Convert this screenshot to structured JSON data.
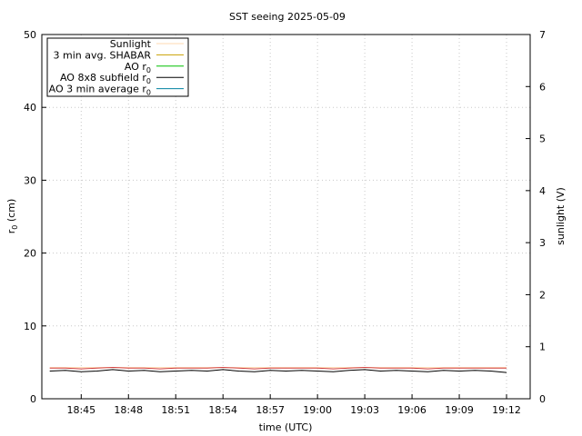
{
  "chart_data": {
    "type": "line",
    "title": "SST seeing 2025-05-09",
    "xlabel": "time (UTC)",
    "ylabel": "r",
    "ylabel_sub": "0",
    "ylabel_unit": " (cm)",
    "y2label": "sunlight (V)",
    "xlim": [
      "18:42:30",
      "18:13:30"
    ],
    "x_range_minutes": [
      1122.5,
      1153.5
    ],
    "ylim": [
      0,
      50
    ],
    "y2lim": [
      0,
      7
    ],
    "x_ticks": [
      "18:45",
      "18:48",
      "18:51",
      "18:54",
      "18:57",
      "19:00",
      "19:03",
      "19:06",
      "19:09",
      "19:12"
    ],
    "y_ticks": [
      0,
      10,
      20,
      30,
      40,
      50
    ],
    "y2_ticks": [
      0,
      1,
      2,
      3,
      4,
      5,
      6,
      7
    ],
    "grid": true,
    "legend_position": "top-left",
    "legend": [
      {
        "label": "Sunlight",
        "sub": "",
        "color": "#ffd9b0"
      },
      {
        "label": "3 min avg. SHABAR",
        "sub": "",
        "color": "#c8a000"
      },
      {
        "label": "AO r",
        "sub": "0",
        "color": "#00c000"
      },
      {
        "label": "AO 8x8 subfield r",
        "sub": "0",
        "color": "#000000"
      },
      {
        "label": "AO 3 min average r",
        "sub": "0",
        "color": "#0080a0"
      }
    ],
    "series": [
      {
        "name": "Sunlight",
        "color": "#ffd9b0",
        "axis": "y2",
        "x_start": "18:43",
        "x_end": "19:12",
        "values": [
          0.6,
          0.6
        ]
      },
      {
        "name": "AO 8x8 subfield r0",
        "color": "#000000",
        "axis": "y",
        "x_start": "18:43",
        "x_end": "19:12",
        "values": [
          3.8,
          3.9,
          3.7,
          3.8,
          4.0,
          3.8,
          3.9,
          3.7,
          3.8,
          3.9,
          3.8,
          4.0,
          3.8,
          3.7,
          3.9,
          3.8,
          3.9,
          3.8,
          3.7,
          3.9,
          4.0,
          3.8,
          3.9,
          3.8,
          3.7,
          3.9,
          3.8,
          3.9,
          3.8,
          3.6
        ]
      },
      {
        "name": "AO r0",
        "color": "#d04040",
        "axis": "y",
        "x_start": "18:43",
        "x_end": "19:12",
        "values": [
          4.2,
          4.2,
          4.1,
          4.2,
          4.3,
          4.2,
          4.2,
          4.1,
          4.2,
          4.2,
          4.2,
          4.3,
          4.2,
          4.1,
          4.2,
          4.2,
          4.2,
          4.2,
          4.1,
          4.2,
          4.3,
          4.2,
          4.2,
          4.2,
          4.1,
          4.2,
          4.2,
          4.2,
          4.2,
          4.2
        ]
      }
    ]
  }
}
